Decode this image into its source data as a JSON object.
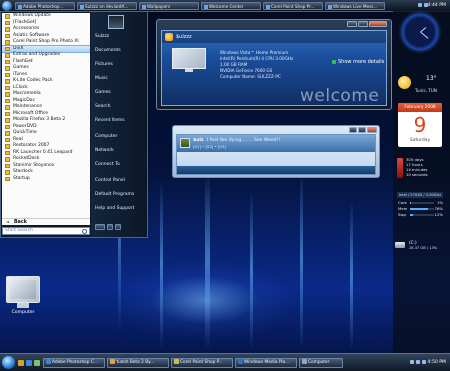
{
  "top_taskbar": {
    "buttons": [
      "Adobe Photoshop...",
      "Sulzzz on deviantA...",
      "Wallpapers",
      "Welcome Center",
      "Corel Paint Shop Pr...",
      "Windows Live Mess..."
    ],
    "clock": "4:44 PM"
  },
  "start_menu": {
    "programs": [
      "Windows Update",
      "[FlashGet]",
      "Accessories",
      "Asiatic Software",
      "Corel Paint Shop Pro Photo XI",
      "DivX",
      "Extras and Upgrades",
      "FlashGet",
      "Games",
      "iTunes",
      "K-Lite Codec Pack",
      "LClock",
      "Macromedia",
      "MagicDoc",
      "Maintenance",
      "Microsoft Office",
      "Mozilla Firefox 3 Beta 2",
      "PowerDVD",
      "QuickTime",
      "Real",
      "Restorator 2007",
      "RK Launcher 0.41 Leopard",
      "RocketDock",
      "Stanimir Stoyanov",
      "Stardock",
      "Startup"
    ],
    "selected_program": "DivX",
    "back_label": "Back",
    "search_placeholder": "Start Search",
    "right_items": [
      "Sulzzz",
      "Documents",
      "Pictures",
      "Music",
      "Games",
      "Search",
      "Recent Items",
      "Computer",
      "Network",
      "Connect To",
      "Control Panel",
      "Default Programs",
      "Help and Support"
    ]
  },
  "welcome_center": {
    "username": "$ulzzz",
    "specs": [
      "Windows Vista™ Home Premium",
      "Intel(R) Pentium(R) 4 CPU 3.00GHz",
      "1.00 GB RAM",
      "NVIDIA GeForce 7600 GS",
      "Computer Name: SULZZZ-PC"
    ],
    "show_more": "Show more details",
    "watermark": "welcome"
  },
  "media_player": {
    "contact": "$ulz",
    "status": "I feel like dying........ See Weed!!",
    "sub": "[01] • [02] • [03]"
  },
  "gadgets": {
    "weather_temp": "13°",
    "weather_location": "Tunis, TUN",
    "calendar_month": "February 2008",
    "calendar_day": "9",
    "calendar_weekday": "Saturday",
    "uptime": [
      "305 days",
      "17 hours",
      "14 minutes",
      "10 seconds"
    ],
    "cpu_header": "Intel / 57XXX / 3.00GHz",
    "meters": [
      {
        "label": "Core",
        "value": "1%",
        "level": 0.01
      },
      {
        "label": "Mem",
        "value": "76%",
        "level": 0.76
      },
      {
        "label": "Swp",
        "value": "12%",
        "level": 0.12
      }
    ],
    "drive_label": "(C:)",
    "drive_info": "28.37 GB / 13%"
  },
  "desktop": {
    "computer_label": "Computer"
  },
  "bottom_taskbar": {
    "buttons": [
      "Adobe Photoshop C...",
      "Yuzoh Beta 2 By...",
      "Corel Paint Shop P...",
      "Windows Media Pla...",
      "Computer"
    ],
    "clock": "4:50 PM"
  },
  "colors": {
    "accent": "#2f7fd0",
    "selection": "#a9d0f4",
    "calendar_red": "#d9441c"
  }
}
